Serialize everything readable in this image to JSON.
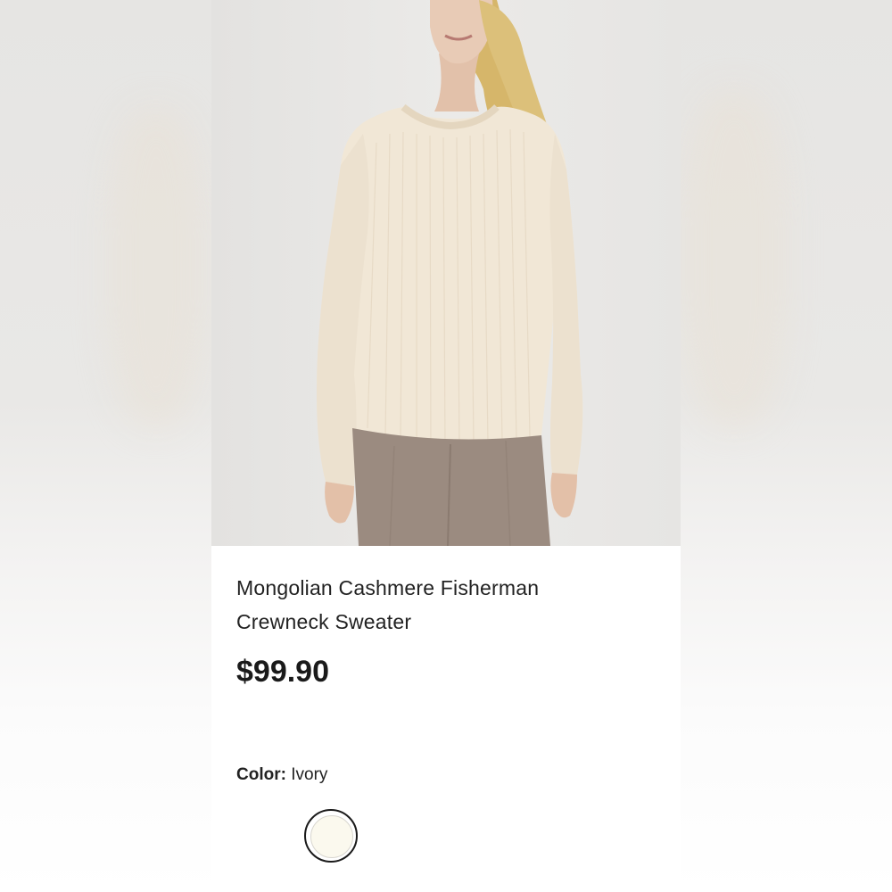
{
  "product": {
    "title_line1": "Mongolian Cashmere Fisherman",
    "title_line2": "Crewneck Sweater",
    "price": "$99.90",
    "color_label": "Color:",
    "color_value": "Ivory"
  },
  "swatches": [
    {
      "name": "Ivory",
      "hex": "#fbf9ee",
      "selected": true
    }
  ],
  "colors": {
    "sweater": "#f1e7d6",
    "trousers": "#9b8b80",
    "hair": "#d9bb72",
    "backdrop": "#e7e6e4"
  }
}
